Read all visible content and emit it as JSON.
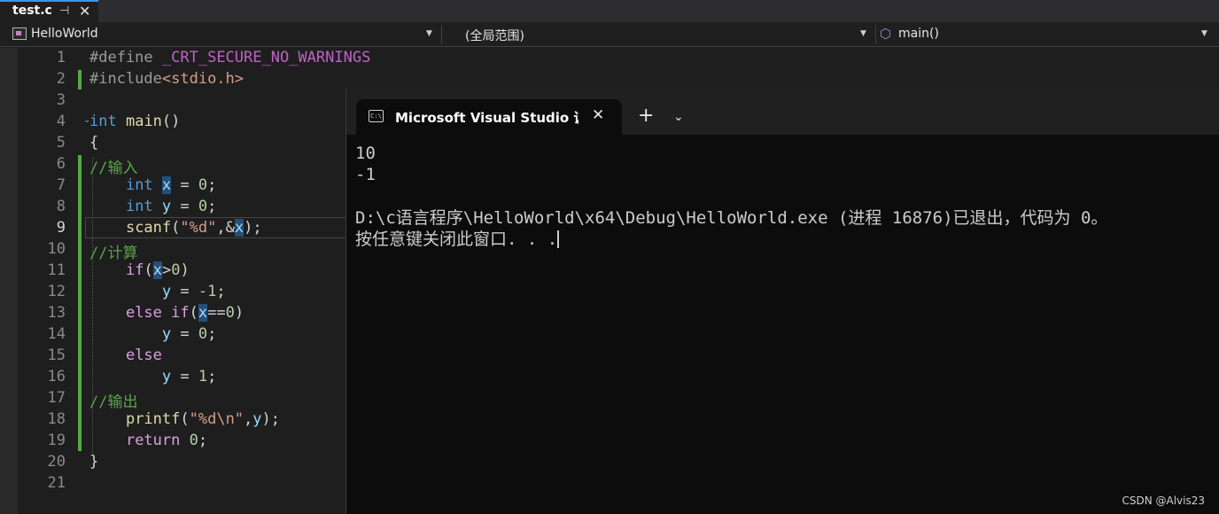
{
  "tab": {
    "title": "test.c",
    "pin_icon": "pin-icon",
    "close_icon": "close-icon",
    "close_glyph": "✕",
    "pin_glyph": "⊣"
  },
  "navbar": {
    "project": "HelloWorld",
    "scope": "(全局范围)",
    "member": "main()"
  },
  "editor": {
    "line_numbers": [
      "1",
      "2",
      "3",
      "4",
      "5",
      "6",
      "7",
      "8",
      "9",
      "10",
      "11",
      "12",
      "13",
      "14",
      "15",
      "16",
      "17",
      "18",
      "19",
      "20",
      "21"
    ],
    "current_line": 9,
    "lines": {
      "l1_pp": "#define",
      "l1_macro": "_CRT_SECURE_NO_WARNINGS",
      "l2_pp": "#include",
      "l2_str": "<stdio.h>",
      "l4_kw": "int",
      "l4_fn": "main",
      "l4_rest": "()",
      "l5": "{",
      "l6": "//输入",
      "l7_kw": "int",
      "l7_var": "x",
      "l7_op": " = ",
      "l7_num": "0",
      "l7_end": ";",
      "l8_kw": "int",
      "l8_var": "y",
      "l8_op": " = ",
      "l8_num": "0",
      "l8_end": ";",
      "l9_fn": "scanf",
      "l9_open": "(",
      "l9_str": "\"%d\"",
      "l9_mid": ",&",
      "l9_var": "x",
      "l9_end": ");",
      "l10": "//计算",
      "l11_kw": "if",
      "l11_open": "(",
      "l11_var": "x",
      "l11_op": ">",
      "l11_num": "0",
      "l11_close": ")",
      "l12_var": "y",
      "l12_op": " = ",
      "l12_num": "-1",
      "l12_end": ";",
      "l13_kw": "else if",
      "l13_open": "(",
      "l13_var": "x",
      "l13_op": "==",
      "l13_num": "0",
      "l13_close": ")",
      "l14_var": "y",
      "l14_op": " = ",
      "l14_num": "0",
      "l14_end": ";",
      "l15_kw": "else",
      "l16_var": "y",
      "l16_op": " = ",
      "l16_num": "1",
      "l16_end": ";",
      "l17": "//输出",
      "l18_fn": "printf",
      "l18_open": "(",
      "l18_str": "\"%d\\n\"",
      "l18_mid": ",",
      "l18_var": "y",
      "l18_end": ");",
      "l19_kw": "return",
      "l19_num": "0",
      "l19_end": ";",
      "l20": "}"
    }
  },
  "terminal": {
    "tab_title": "Microsoft Visual Studio 调试控制台",
    "icon_text": "C:\\",
    "plus": "+",
    "chevron": "⌄",
    "close": "✕",
    "output": [
      "10",
      "-1",
      "",
      "D:\\c语言程序\\HelloWorld\\x64\\Debug\\HelloWorld.exe (进程 16876)已退出，代码为 0。",
      "按任意键关闭此窗口. . ."
    ]
  },
  "watermark": "CSDN @Alvis23",
  "colors": {
    "accent": "#3794ff",
    "comment": "#57a64a",
    "keyword": "#569cd6",
    "string": "#d69d85"
  }
}
